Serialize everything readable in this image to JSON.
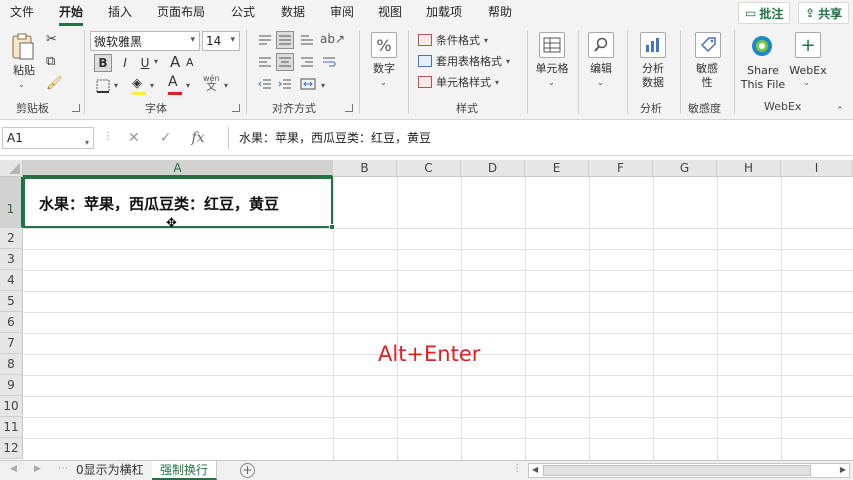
{
  "menu": {
    "tabs": [
      "文件",
      "开始",
      "插入",
      "页面布局",
      "公式",
      "数据",
      "审阅",
      "视图",
      "加载项",
      "帮助"
    ],
    "active": "开始",
    "comments_label": "批注",
    "share_label": "共享"
  },
  "ribbon": {
    "clipboard": {
      "paste_label": "粘贴",
      "group_label": "剪贴板"
    },
    "font": {
      "font_name": "微软雅黑",
      "font_size": "14",
      "bold": "B",
      "italic": "I",
      "underline": "U",
      "font_color_glyph": "A",
      "phonetic_glyph": "wén",
      "phonetic_glyph_sub": "文",
      "grow": "A",
      "shrink": "A",
      "group_label": "字体"
    },
    "alignment": {
      "group_label": "对齐方式"
    },
    "number": {
      "label": "数字",
      "icon": "%"
    },
    "styles": {
      "conditional": "条件格式",
      "table_format": "套用表格格式",
      "cell_styles": "单元格样式",
      "group_label": "样式"
    },
    "cells": {
      "label": "单元格"
    },
    "editing": {
      "label": "编辑"
    },
    "analysis": {
      "label_line1": "分析",
      "label_line2": "数据",
      "group_label": "分析"
    },
    "sensitivity": {
      "label_line1": "敏感",
      "label_line2": "性",
      "group_label": "敏感度"
    },
    "webex": {
      "share_line1": "Share",
      "share_line2": "This File",
      "webex_label": "WebEx",
      "group_label": "WebEx"
    }
  },
  "formula_bar": {
    "name_box": "A1",
    "cancel_glyph": "✕",
    "enter_glyph": "✓",
    "fx_glyph": "fx",
    "content": "水果：苹果，西瓜豆类：红豆，黄豆"
  },
  "grid": {
    "columns": [
      "A",
      "B",
      "C",
      "D",
      "E",
      "F",
      "G",
      "H",
      "I"
    ],
    "rows": [
      "1",
      "2",
      "3",
      "4",
      "5",
      "6",
      "7",
      "8",
      "9",
      "10",
      "11",
      "12"
    ],
    "selected_cell": "A1",
    "cell_A1": "水果：苹果，西瓜豆类：红豆，黄豆"
  },
  "overlay_text": "Alt+Enter",
  "sheets": {
    "tabs": [
      "0显示为横杠",
      "强制换行"
    ],
    "active": "强制换行",
    "add_glyph": "+"
  },
  "colors": {
    "accent": "#217346",
    "overlay": "#e02020"
  }
}
